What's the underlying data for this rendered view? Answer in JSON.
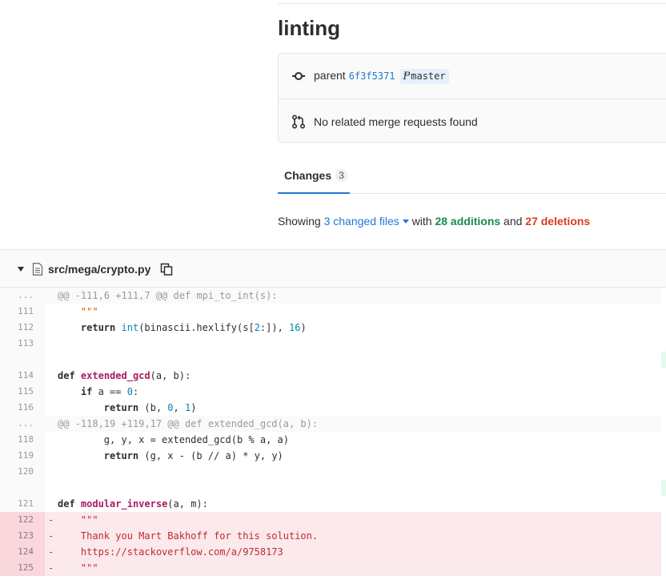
{
  "commit": {
    "title": "linting",
    "parent_label": "parent",
    "parent_sha": "6f3f5371",
    "branch": "master",
    "merge_requests_text": "No related merge requests found"
  },
  "tabs": {
    "changes_label": "Changes",
    "changes_count": "3"
  },
  "summary": {
    "showing": "Showing",
    "files_changed": "3 changed files",
    "with": "with",
    "additions": "28 additions",
    "and": "and",
    "deletions": "27 deletions"
  },
  "file": {
    "path": "src/mega/crypto.py"
  },
  "colors": {
    "link": "#1f78d1",
    "additions": "#168f48",
    "deletions": "#db3b21",
    "removed_line_bg": "#fbe9eb"
  },
  "diff_lines": [
    {
      "kind": "match",
      "num": "...",
      "text": "@@ -111,6 +111,7 @@ def mpi_to_int(s):"
    },
    {
      "kind": "context",
      "num": "111",
      "text": "    \"\"\""
    },
    {
      "kind": "context",
      "num": "112",
      "text": "    return int(binascii.hexlify(s[2:]), 16)"
    },
    {
      "kind": "context",
      "num": "113",
      "text": ""
    },
    {
      "kind": "context",
      "num": "",
      "text": ""
    },
    {
      "kind": "context",
      "num": "114",
      "text": "def extended_gcd(a, b):"
    },
    {
      "kind": "context",
      "num": "115",
      "text": "    if a == 0:"
    },
    {
      "kind": "context",
      "num": "116",
      "text": "        return (b, 0, 1)"
    },
    {
      "kind": "match",
      "num": "...",
      "text": "@@ -118,19 +119,17 @@ def extended_gcd(a, b):"
    },
    {
      "kind": "context",
      "num": "118",
      "text": "        g, y, x = extended_gcd(b % a, a)"
    },
    {
      "kind": "context",
      "num": "119",
      "text": "        return (g, x - (b // a) * y, y)"
    },
    {
      "kind": "context",
      "num": "120",
      "text": ""
    },
    {
      "kind": "context",
      "num": "",
      "text": ""
    },
    {
      "kind": "context",
      "num": "121",
      "text": "def modular_inverse(a, m):"
    },
    {
      "kind": "old",
      "num": "122",
      "text": "    \"\"\""
    },
    {
      "kind": "old",
      "num": "123",
      "text": "    Thank you Mart Bakhoff for this solution."
    },
    {
      "kind": "old",
      "num": "124",
      "text": "    https://stackoverflow.com/a/9758173"
    },
    {
      "kind": "old",
      "num": "125",
      "text": "    \"\"\""
    }
  ]
}
